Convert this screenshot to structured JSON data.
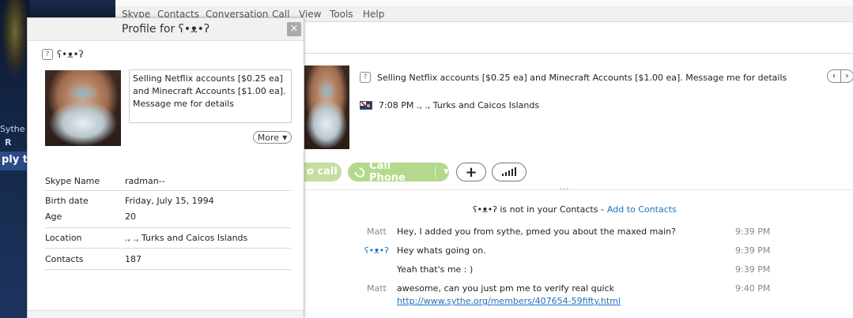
{
  "background": {
    "sythe_text": "Sythe",
    "r_text": "R",
    "reply_text": "ply t"
  },
  "menu": [
    "Skype",
    "Contacts",
    "Conversation",
    "Call",
    "View",
    "Tools",
    "Help"
  ],
  "profile": {
    "title": "Profile for ʕ•ᴥ•ʔ",
    "display_name": "ʕ•ᴥ•ʔ",
    "close_label": "×",
    "mood": "Selling Netflix accounts [$0.25 ea] and Minecraft Accounts [$1.00 ea]. Message me for details",
    "more_label": "More",
    "fields": {
      "skype_name_label": "Skype Name",
      "skype_name": "radman--",
      "birth_date_label": "Birth date",
      "birth_date": "Friday, July 15, 1994",
      "age_label": "Age",
      "age": "20",
      "location_label": "Location",
      "location": "., ., Turks and Caicos Islands",
      "contacts_label": "Contacts",
      "contacts": "187"
    }
  },
  "conversation": {
    "mood": "Selling Netflix accounts [$0.25 ea] and Minecraft Accounts [$1.00 ea]. Message me for details",
    "local_time": "7:08 PM ., ., Turks and Caicos Islands",
    "nav_prev": "‹",
    "nav_next": "›",
    "video_call_label": "o call",
    "call_phone_label": "Call Phone",
    "add_label": "+",
    "divider_dots": "...",
    "not_in_contacts": "ʕ•ᴥ•ʔ is not in your Contacts -",
    "add_to_contacts": "Add to Contacts",
    "messages": [
      {
        "sender": "Matt",
        "text": "Hey, I added you from sythe, pmed you about the maxed main?",
        "time": "9:39 PM"
      },
      {
        "sender": "ʕ•ᴥ•ʔ",
        "text": "Hey whats going on.",
        "time": "9:39 PM"
      },
      {
        "sender": "",
        "text": "Yeah that's me : )",
        "time": "9:39 PM"
      },
      {
        "sender": "Matt",
        "text": "awesome, can you just pm me to verify real quick",
        "time": "9:40 PM",
        "link": "http://www.sythe.org/members/407654-59fifty.html"
      }
    ]
  },
  "colors": {
    "accent_blue": "#1e73be",
    "call_green": "#b5d98c",
    "video_green": "#c4dea0"
  }
}
